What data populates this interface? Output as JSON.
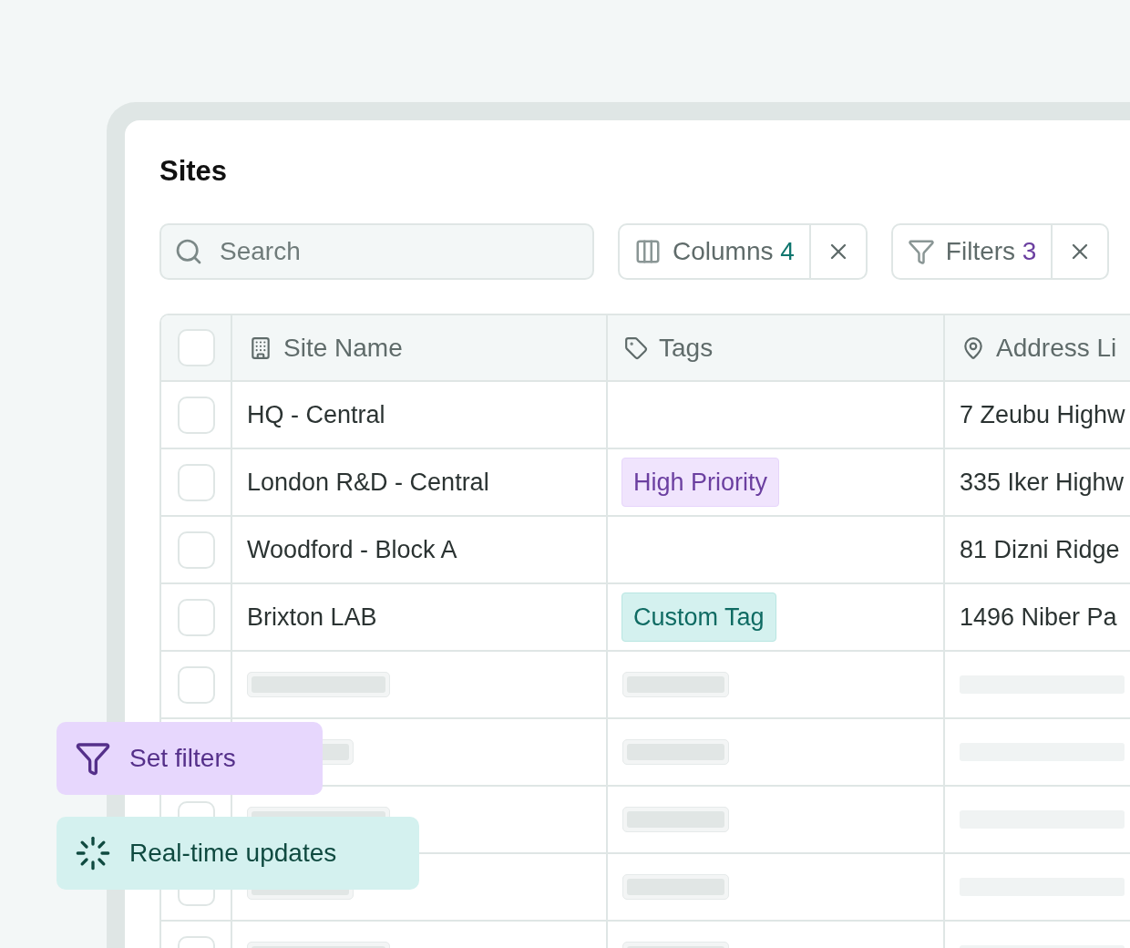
{
  "title": "Sites",
  "search": {
    "placeholder": "Search"
  },
  "toolbar": [
    {
      "kind": "columns",
      "label": "Columns",
      "count": "4",
      "color": "#0f766e"
    },
    {
      "kind": "filters",
      "label": "Filters",
      "count": "3",
      "color": "#6b3fa0"
    }
  ],
  "table": {
    "columns": [
      {
        "kind": "name",
        "label": "Site Name"
      },
      {
        "kind": "tags",
        "label": "Tags"
      },
      {
        "kind": "address",
        "label": "Address Li"
      }
    ],
    "header_checked": false,
    "rows": [
      {
        "kind": "data",
        "checked": false,
        "name": "HQ - Central",
        "address": "7 Zeubu Highw"
      },
      {
        "kind": "data",
        "checked": false,
        "name": "London R&D - Central",
        "tag": {
          "label": "High Priority",
          "color": "#f0e4fd"
        },
        "address": "335 Iker Highw"
      },
      {
        "kind": "data",
        "checked": false,
        "name": "Woodford - Block A",
        "address": "81 Dizni Ridge"
      },
      {
        "kind": "data",
        "checked": false,
        "name": "Brixton LAB",
        "tag": {
          "label": "Custom Tag",
          "color": "#d4f1ef"
        },
        "address": "1496 Niber Pa"
      },
      {
        "kind": "loading",
        "checked": false
      },
      {
        "kind": "loading"
      },
      {
        "kind": "loading",
        "checked": false
      },
      {
        "kind": "loading",
        "checked": false
      },
      {
        "kind": "loading",
        "checked": false
      }
    ]
  },
  "callouts": [
    {
      "kind": "filters",
      "label": "Set filters"
    },
    {
      "kind": "updates",
      "label": "Real-time updates"
    }
  ]
}
